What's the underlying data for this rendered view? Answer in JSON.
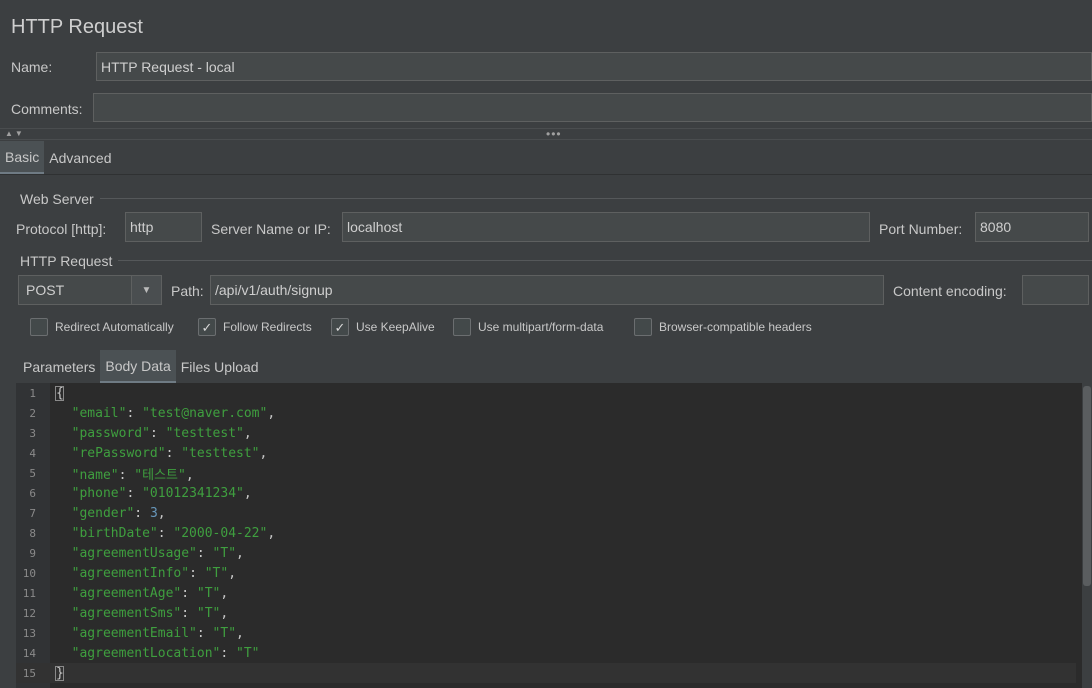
{
  "window": {
    "title": "HTTP Request"
  },
  "form": {
    "name_label": "Name:",
    "name_value": "HTTP Request - local",
    "comments_label": "Comments:",
    "comments_value": ""
  },
  "tabs": [
    {
      "label": "Basic",
      "active": true
    },
    {
      "label": "Advanced",
      "active": false
    }
  ],
  "web_server": {
    "group_label": "Web Server",
    "protocol_label": "Protocol [http]:",
    "protocol_value": "http",
    "server_label": "Server Name or IP:",
    "server_value": "localhost",
    "port_label": "Port Number:",
    "port_value": "8080"
  },
  "http_request": {
    "group_label": "HTTP Request",
    "method": "POST",
    "path_label": "Path:",
    "path_value": "/api/v1/auth/signup",
    "encoding_label": "Content encoding:",
    "encoding_value": ""
  },
  "checkboxes": [
    {
      "label": "Redirect Automatically",
      "checked": false
    },
    {
      "label": "Follow Redirects",
      "checked": true
    },
    {
      "label": "Use KeepAlive",
      "checked": true
    },
    {
      "label": "Use multipart/form-data",
      "checked": false
    },
    {
      "label": "Browser-compatible headers",
      "checked": false
    }
  ],
  "sub_tabs": [
    {
      "label": "Parameters",
      "active": false
    },
    {
      "label": "Body Data",
      "active": true
    },
    {
      "label": "Files Upload",
      "active": false
    }
  ],
  "body_lines": [
    {
      "n": "1",
      "text": "{"
    },
    {
      "n": "2",
      "key": "\"email\"",
      "val": "\"test@naver.com\"",
      "type": "s",
      "comma": ","
    },
    {
      "n": "3",
      "key": "\"password\"",
      "val": "\"testtest\"",
      "type": "s",
      "comma": ","
    },
    {
      "n": "4",
      "key": "\"rePassword\"",
      "val": "\"testtest\"",
      "type": "s",
      "comma": ","
    },
    {
      "n": "5",
      "key": "\"name\"",
      "val": "\"테스트\"",
      "type": "s",
      "comma": ","
    },
    {
      "n": "6",
      "key": "\"phone\"",
      "val": "\"01012341234\"",
      "type": "s",
      "comma": ","
    },
    {
      "n": "7",
      "key": "\"gender\"",
      "val": "3",
      "type": "n",
      "comma": ","
    },
    {
      "n": "8",
      "key": "\"birthDate\"",
      "val": "\"2000-04-22\"",
      "type": "s",
      "comma": ","
    },
    {
      "n": "9",
      "key": "\"agreementUsage\"",
      "val": "\"T\"",
      "type": "s",
      "comma": ","
    },
    {
      "n": "10",
      "key": "\"agreementInfo\"",
      "val": "\"T\"",
      "type": "s",
      "comma": ","
    },
    {
      "n": "11",
      "key": "\"agreementAge\"",
      "val": "\"T\"",
      "type": "s",
      "comma": ","
    },
    {
      "n": "12",
      "key": "\"agreementSms\"",
      "val": "\"T\"",
      "type": "s",
      "comma": ","
    },
    {
      "n": "13",
      "key": "\"agreementEmail\"",
      "val": "\"T\"",
      "type": "s",
      "comma": ","
    },
    {
      "n": "14",
      "key": "\"agreementLocation\"",
      "val": "\"T\"",
      "type": "s",
      "comma": ""
    },
    {
      "n": "15",
      "text": "}"
    }
  ],
  "colors": {
    "background": "#3c3f41",
    "editor_bg": "#2b2b2b",
    "string": "#3f9f3f",
    "number": "#6897bb"
  }
}
